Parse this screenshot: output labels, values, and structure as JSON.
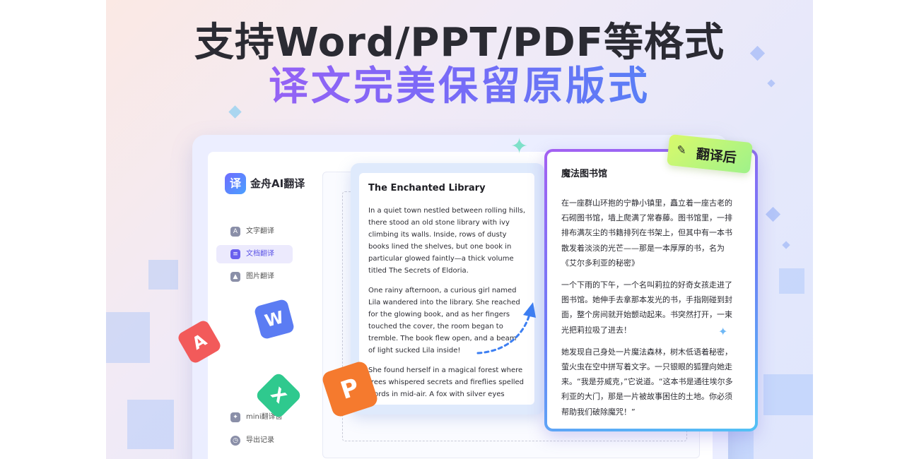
{
  "headline": {
    "line1": "支持Word/PPT/PDF等格式",
    "line2": "译文完美保留原版式"
  },
  "app": {
    "logo_glyph": "译",
    "name": "金舟AI翻译",
    "nav": [
      {
        "label": "文字翻译",
        "icon": "text-translate-icon",
        "active": false
      },
      {
        "label": "文档翻译",
        "icon": "doc-translate-icon",
        "active": true
      },
      {
        "label": "图片翻译",
        "icon": "image-translate-icon",
        "active": false
      }
    ],
    "bottom_nav": [
      {
        "label": "mini翻译窗",
        "icon": "mini-window-icon"
      },
      {
        "label": "导出记录",
        "icon": "clock-icon"
      }
    ]
  },
  "source_doc": {
    "title": "The Enchanted Library",
    "paragraphs": [
      "In a quiet town nestled between rolling hills, there stood an old stone library with ivy climbing its walls. Inside, rows of dusty books lined the shelves, but one book in particular glowed faintly—a thick volume titled The Secrets of Eldoria.",
      "One rainy afternoon, a curious girl named Lila wandered into the library. She reached for the glowing book, and as her fingers touched the cover, the room began to tremble. The book flew open, and a beam of light sucked Lila inside!",
      "She found herself in a magical forest where trees whispered secrets and fireflies spelled words in mid-air. A fox with silver eyes"
    ]
  },
  "translated_doc": {
    "title": "魔法图书馆",
    "paragraphs": [
      "在一座群山环抱的宁静小镇里，矗立着一座古老的石砌图书馆，墙上爬满了常春藤。图书馆里，一排排布满灰尘的书籍排列在书架上，但其中有一本书散发着淡淡的光芒——那是一本厚厚的书，名为《艾尔多利亚的秘密》",
      "一个下雨的下午，一个名叫莉拉的好奇女孩走进了图书馆。她伸手去拿那本发光的书，手指刚碰到封面，整个房间就开始颤动起来。书突然打开，一束光把莉拉吸了进去！",
      "她发现自己身处一片魔法森林，树木低语着秘密，萤火虫在空中拼写着文字。一只银眼的狐狸向她走来。“我是芬威克，”它说道。“这本书是通往埃尔多利亚的大门，那是一片被故事困住的土地。你必须帮助我们破除魔咒！”"
    ]
  },
  "badge": {
    "label": "翻译后",
    "icon": "magic-wand-icon"
  },
  "file_icons": [
    {
      "name": "pdf-icon",
      "glyph": "A",
      "color": "#f25a5a"
    },
    {
      "name": "word-icon",
      "glyph": "W",
      "color": "#5b7cf3"
    },
    {
      "name": "excel-icon",
      "glyph": "X",
      "color": "#2fc98e"
    },
    {
      "name": "ppt-icon",
      "glyph": "P",
      "color": "#f57a2e"
    }
  ]
}
